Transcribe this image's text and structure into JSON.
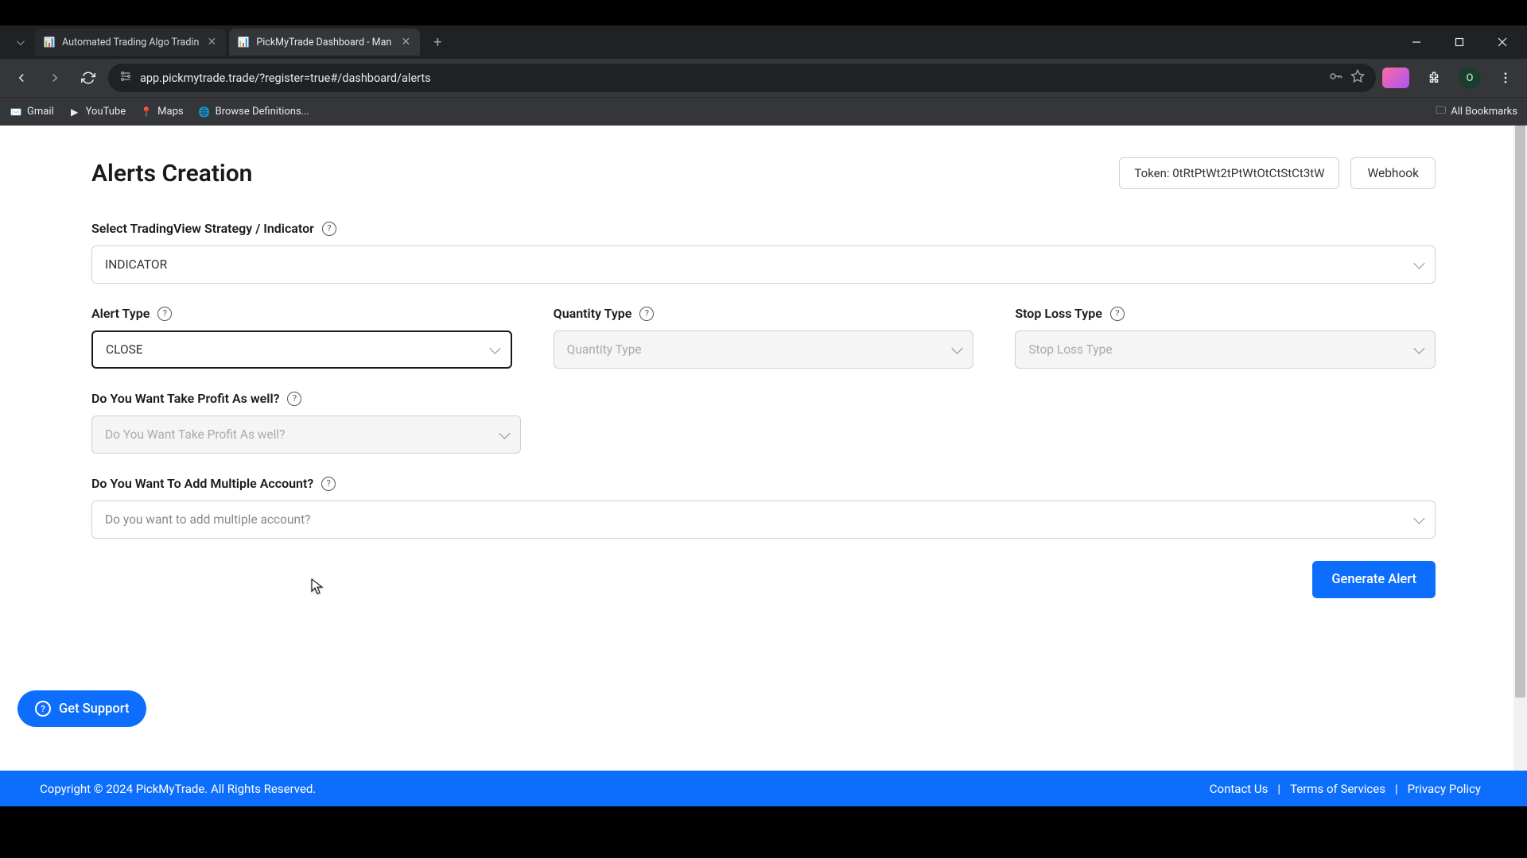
{
  "browser": {
    "tabs": [
      {
        "title": "Automated Trading Algo Tradin",
        "active": false
      },
      {
        "title": "PickMyTrade Dashboard - Man",
        "active": true
      }
    ],
    "url": "app.pickmytrade.trade/?register=true#/dashboard/alerts",
    "bookmarks": [
      {
        "label": "Gmail"
      },
      {
        "label": "YouTube"
      },
      {
        "label": "Maps"
      },
      {
        "label": "Browse Definitions..."
      }
    ],
    "all_bookmarks": "All Bookmarks",
    "profile_initial": "O"
  },
  "page": {
    "title": "Alerts Creation",
    "token_label": "Token: 0tRtPtWt2tPtWtOtCtStCt3tW",
    "webhook": "Webhook",
    "fields": {
      "strategy": {
        "label": "Select TradingView Strategy / Indicator",
        "value": "INDICATOR"
      },
      "alert_type": {
        "label": "Alert Type",
        "value": "CLOSE"
      },
      "quantity_type": {
        "label": "Quantity Type",
        "placeholder": "Quantity Type"
      },
      "stop_loss": {
        "label": "Stop Loss Type",
        "placeholder": "Stop Loss Type"
      },
      "take_profit": {
        "label": "Do You Want Take Profit As well?",
        "placeholder": "Do You Want Take Profit As well?"
      },
      "multi_account": {
        "label": "Do You Want To Add Multiple Account?",
        "placeholder": "Do you want to add multiple account?"
      }
    },
    "generate": "Generate Alert",
    "support": "Get Support"
  },
  "footer": {
    "copyright": "Copyright © 2024 PickMyTrade. All Rights Reserved.",
    "links": {
      "contact": "Contact Us",
      "terms": "Terms of Services",
      "privacy": "Privacy Policy"
    }
  }
}
